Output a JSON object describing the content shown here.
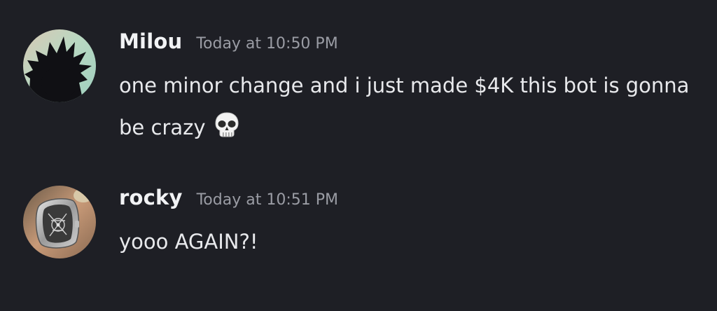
{
  "messages": [
    {
      "username": "Milou",
      "timestamp": "Today at 10:50 PM",
      "text": "one minor change and i just made $4K this bot is gonna be crazy",
      "emoji": "skull-emoji",
      "avatar": "dark silhouette of anime character on pastel gradient background"
    },
    {
      "username": "rocky",
      "timestamp": "Today at 10:51 PM",
      "text": "yooo AGAIN?!",
      "avatar": "photo of a tonneau-shaped skeleton luxury wristwatch on a wrist"
    }
  ],
  "colors": {
    "background": "#1e1f25",
    "username": "#f2f3f5",
    "timestamp": "#9a9ca4",
    "message_text": "#e8e9ec"
  }
}
